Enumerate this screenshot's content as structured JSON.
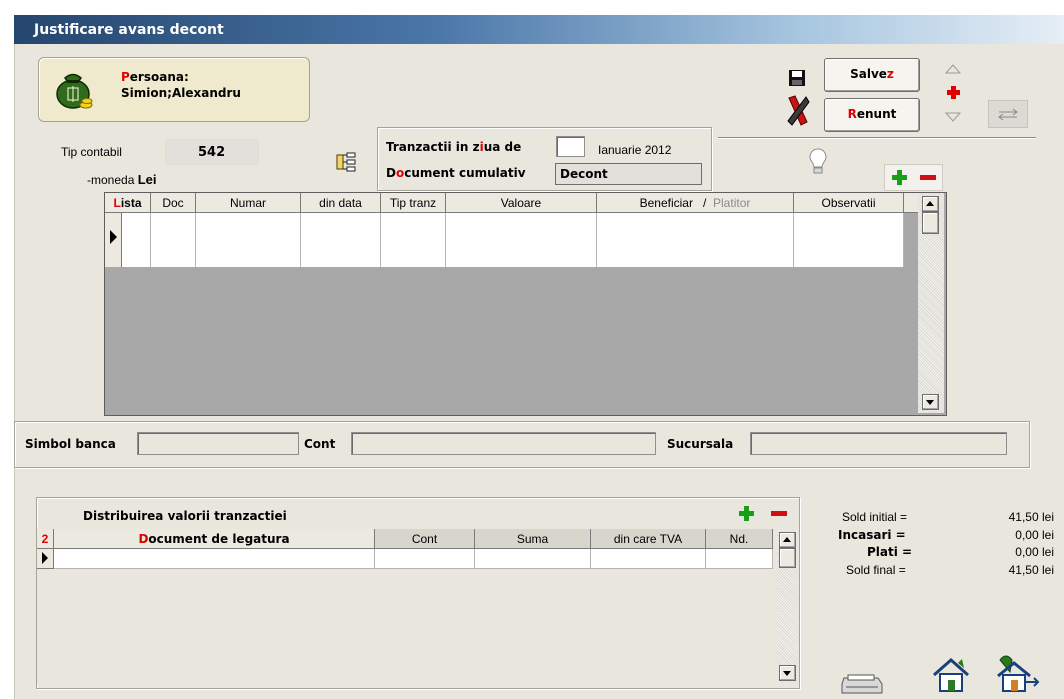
{
  "window": {
    "title": "Justificare avans decont"
  },
  "person": {
    "label_first": "P",
    "label_rest": "ersoana:",
    "name": "Simion;Alexandru"
  },
  "buttons": {
    "save": {
      "pre": "Salve",
      "hot": "z"
    },
    "cancel": {
      "hot": "R",
      "post": "enunt"
    }
  },
  "tip_contabil": {
    "label": "Tip contabil",
    "value": "542"
  },
  "moneda": {
    "label": "-moneda",
    "value": "Lei"
  },
  "tranzactii": {
    "label_pre": "Tranzactii in z",
    "label_hot": "i",
    "label_post": "ua de",
    "day": "",
    "month": "Ianuarie 2012",
    "doc_pre": "D",
    "doc_hot": "o",
    "doc_post": "cument cumulativ",
    "doc_value": "Decont"
  },
  "main_table": {
    "headers": {
      "lista": "Lista",
      "lista_hot": "L",
      "doc": "Doc",
      "numar": "Numar",
      "din_data": "din data",
      "tip_tranz": "Tip tranz",
      "valoare": "Valoare",
      "beneficiar": "Beneficiar",
      "slash": "/",
      "platitor": "Platitor",
      "observatii": "Observatii"
    }
  },
  "bank": {
    "simbol_label": "Simbol banca",
    "cont_label": "Cont",
    "sucursala_label": "Sucursala",
    "simbol_value": "",
    "cont_value": "",
    "sucursala_value": ""
  },
  "distrib": {
    "title": "Distribuirea valorii tranzactiei",
    "row_num": "2",
    "headers": {
      "doc_hot": "D",
      "doc_rest": "ocument de legatura",
      "cont": "Cont",
      "suma": "Suma",
      "tva": "din care TVA",
      "nd": "Nd."
    }
  },
  "summary": {
    "sold_initial_label": "Sold initial =",
    "sold_initial_value": "41,50 lei",
    "incasari_label": "Incasari =",
    "incasari_value": "0,00 lei",
    "plati_label": "Plati =",
    "plati_value": "0,00 lei",
    "sold_final_label": "Sold final =",
    "sold_final_value": "41,50 lei"
  },
  "colors": {
    "accent_red": "#e00000",
    "title_start": "#25466e",
    "plus_green": "#17a017"
  },
  "icons": [
    "money-bag-icon",
    "save-disk-icon",
    "cancel-x-icon",
    "up-arrow-icon",
    "red-plus-icon",
    "down-arrow-icon",
    "arrows-icon",
    "tree-icon",
    "lightbulb-icon",
    "add-icon",
    "remove-icon",
    "printer-icon",
    "home-icon",
    "home-exit-icon"
  ]
}
